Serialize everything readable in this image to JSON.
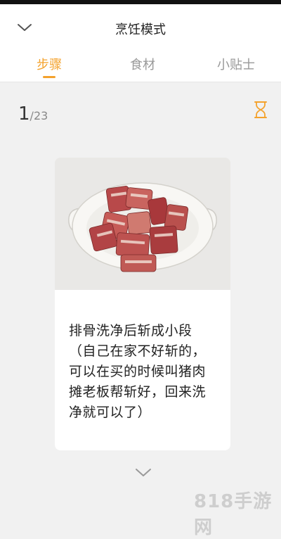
{
  "header": {
    "title": "烹饪模式",
    "tabs": [
      {
        "label": "步骤",
        "active": true
      },
      {
        "label": "食材",
        "active": false
      },
      {
        "label": "小贴士",
        "active": false
      }
    ]
  },
  "step": {
    "current": "1",
    "total": "/23",
    "description": "排骨洗净后斩成小段（自己在家不好斩的，可以在买的时候叫猪肉摊老板帮斩好，回来洗净就可以了）"
  },
  "icons": {
    "collapse": "chevron-down-icon",
    "timer": "hourglass-icon",
    "next": "chevron-down-icon"
  },
  "colors": {
    "accent": "#f4a22c",
    "background": "#f1f1f1"
  },
  "watermark": "818手游网"
}
